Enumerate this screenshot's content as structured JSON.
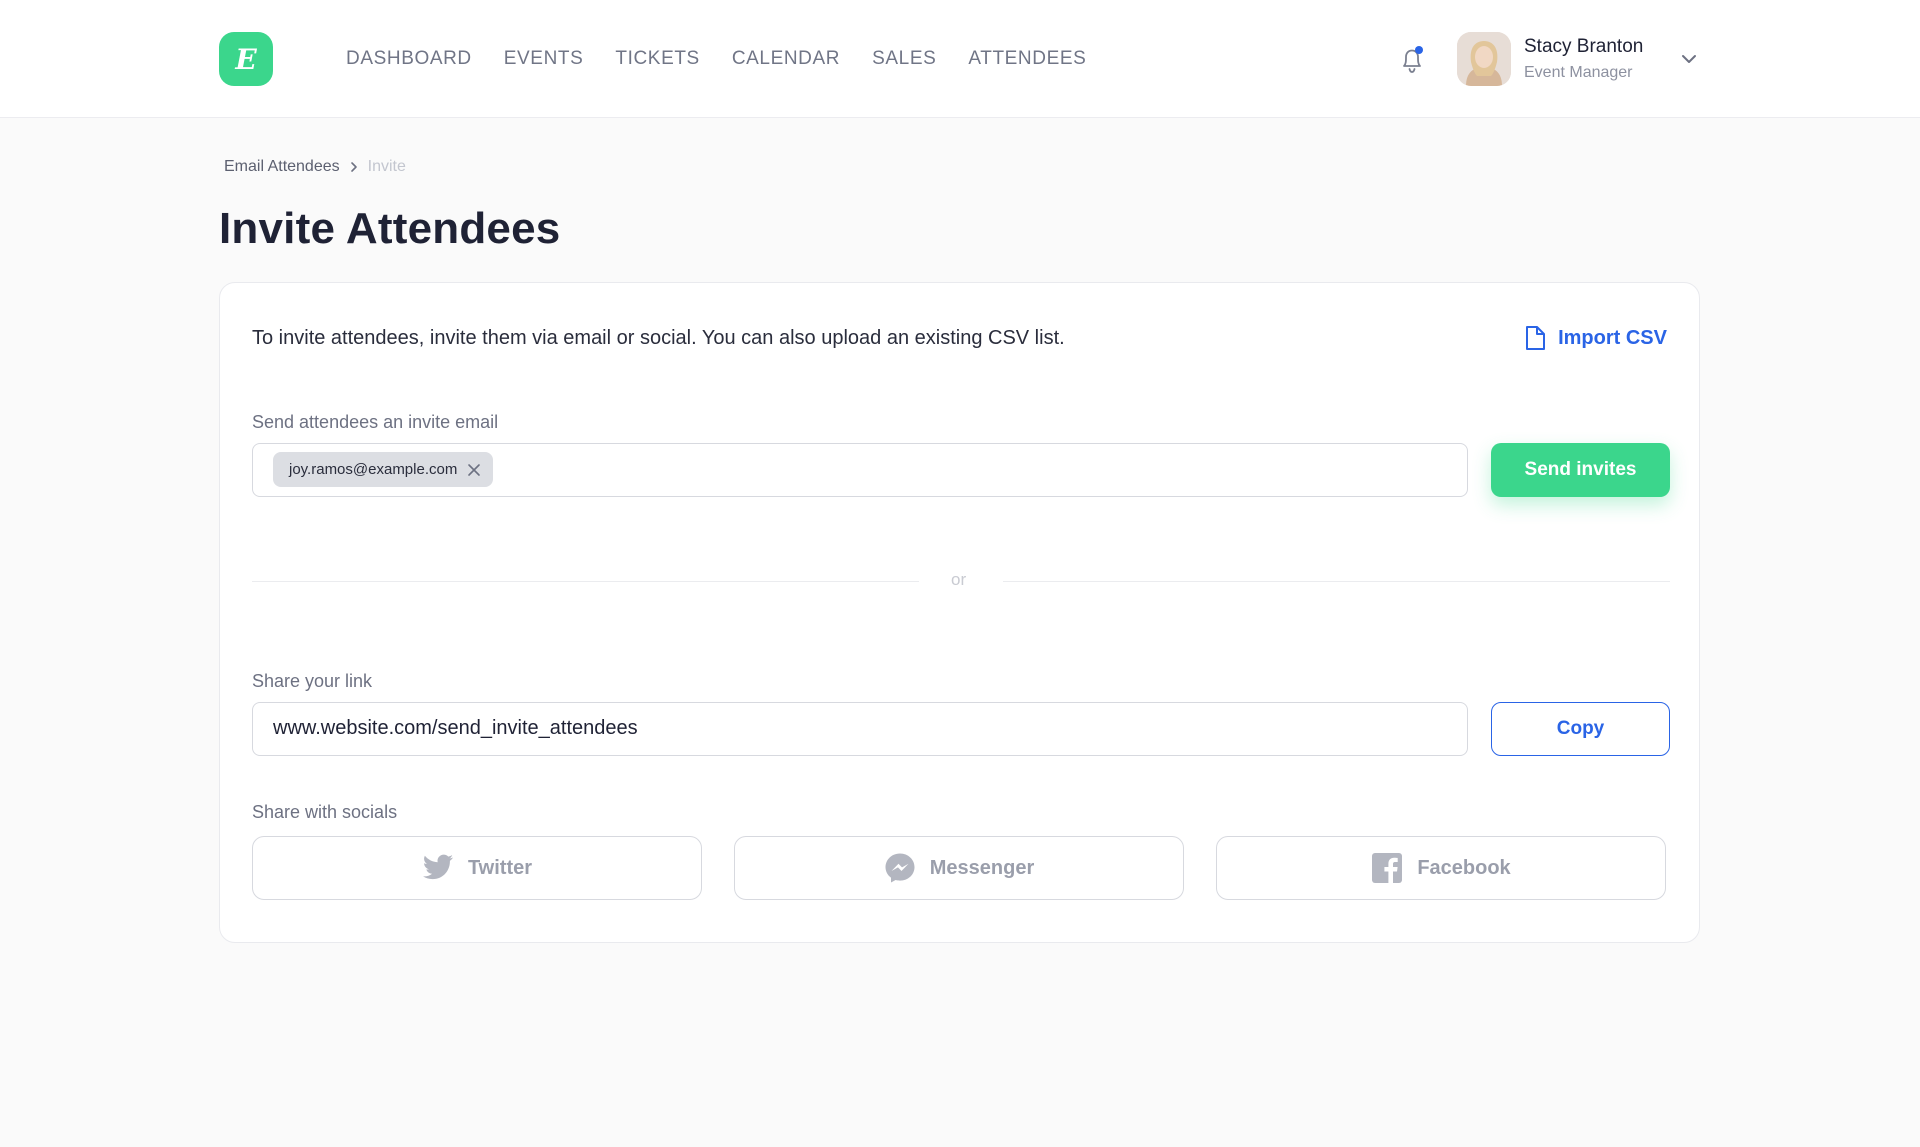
{
  "app": {
    "logo_letter": "E",
    "accent": "#3bd68c",
    "link_color": "#2a64e6"
  },
  "nav": {
    "items": [
      {
        "label": "DASHBOARD"
      },
      {
        "label": "EVENTS"
      },
      {
        "label": "TICKETS"
      },
      {
        "label": "CALENDAR"
      },
      {
        "label": "SALES"
      },
      {
        "label": "ATTENDEES"
      }
    ]
  },
  "user": {
    "name": "Stacy Branton",
    "role": "Event Manager",
    "has_notification": true,
    "icons": [
      "bell-icon",
      "avatar",
      "chevron-down-icon"
    ]
  },
  "breadcrumb": {
    "parent": "Email Attendees",
    "current": "Invite"
  },
  "page": {
    "title": "Invite Attendees"
  },
  "card": {
    "intro": "To invite attendees, invite them via email or social. You can also upload an existing CSV list.",
    "import_label": "Import CSV",
    "email_section": {
      "label": "Send attendees an invite email",
      "chips": [
        "joy.ramos@example.com"
      ],
      "send_label": "Send invites"
    },
    "divider_text": "or",
    "link_section": {
      "label": "Share your link",
      "value": "www.website.com/send_invite_attendees",
      "copy_label": "Copy"
    },
    "socials": {
      "label": "Share with socials",
      "buttons": [
        {
          "label": "Twitter",
          "icon": "twitter-icon"
        },
        {
          "label": "Messenger",
          "icon": "messenger-icon"
        },
        {
          "label": "Facebook",
          "icon": "facebook-icon"
        }
      ]
    }
  }
}
